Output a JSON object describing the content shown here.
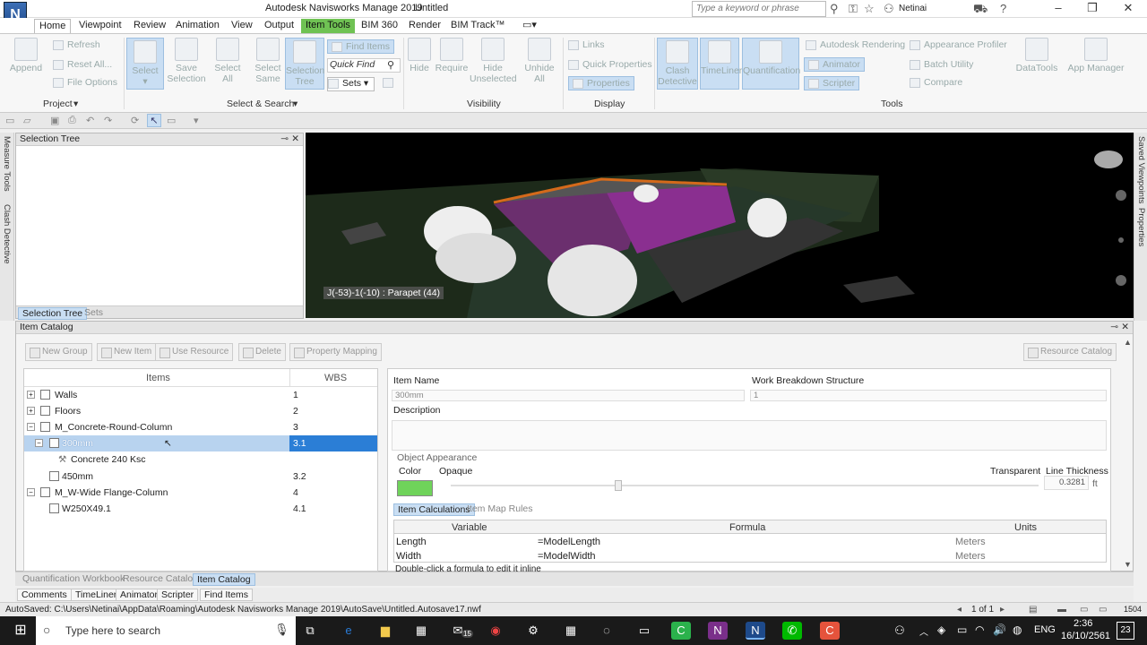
{
  "titlebar": {
    "app_title": "Autodesk Navisworks Manage 2019",
    "doc_title": "Untitled",
    "logo_letter": "N",
    "search_placeholder": "Type a keyword or phrase",
    "user": "Netinai"
  },
  "tabs": [
    "Home",
    "Viewpoint",
    "Review",
    "Animation",
    "View",
    "Output",
    "Item Tools",
    "BIM 360",
    "Render",
    "BIM Track™"
  ],
  "ribbon": {
    "project": {
      "append": "Append",
      "refresh": "Refresh",
      "reset_all": "Reset All...",
      "file_options": "File Options",
      "label": "Project"
    },
    "select_search": {
      "select": "Select",
      "save_selection": "Save Selection",
      "select_all": "Select All",
      "select_same": "Select Same",
      "selection_tree": "Selection Tree",
      "find_items": "Find Items",
      "quick_find": "Quick Find",
      "sets": "Sets",
      "label": "Select & Search"
    },
    "visibility": {
      "hide": "Hide",
      "require": "Require",
      "hide_unselected": "Hide Unselected",
      "unhide_all": "Unhide All",
      "label": "Visibility"
    },
    "display": {
      "links": "Links",
      "quick_properties": "Quick Properties",
      "properties": "Properties",
      "label": "Display"
    },
    "tools": {
      "clash_detective": "Clash Detective",
      "timeliner": "TimeLiner",
      "quantification": "Quantification",
      "autodesk_rendering": "Autodesk Rendering",
      "animator": "Animator",
      "scripter": "Scripter",
      "appearance_profiler": "Appearance Profiler",
      "batch_utility": "Batch Utility",
      "compare": "Compare",
      "datatools": "DataTools",
      "app_manager": "App Manager",
      "label": "Tools"
    }
  },
  "side_left": [
    "Measure Tools",
    "Clash Detective"
  ],
  "side_right": [
    "Saved Viewpoints",
    "Properties"
  ],
  "selection_tree": {
    "title": "Selection Tree",
    "tabs": [
      "Selection Tree",
      "Sets"
    ]
  },
  "viewport": {
    "tooltip": "J(-53)-1(-10) : Parapet (44)"
  },
  "item_catalog": {
    "title": "Item Catalog",
    "buttons": [
      "New Group",
      "New Item",
      "Use Resource",
      "Delete",
      "Property Mapping"
    ],
    "resource_catalog": "Resource Catalog",
    "tree_headers": {
      "items": "Items",
      "wbs": "WBS"
    },
    "tree_rows": [
      {
        "name": "Walls",
        "wbs": "1"
      },
      {
        "name": "Floors",
        "wbs": "2"
      },
      {
        "name": "M_Concrete-Round-Column",
        "wbs": "3"
      },
      {
        "name": "300mm",
        "wbs": "3.1"
      },
      {
        "name": "Concrete 240 Ksc",
        "wbs": ""
      },
      {
        "name": "450mm",
        "wbs": "3.2"
      },
      {
        "name": "M_W-Wide Flange-Column",
        "wbs": "4"
      },
      {
        "name": "W250X49.1",
        "wbs": "4.1"
      }
    ],
    "details": {
      "item_name_label": "Item Name",
      "item_name_value": "300mm",
      "wbs_label": "Work Breakdown Structure",
      "wbs_value": "1",
      "description_label": "Description",
      "object_appearance": "Object Appearance",
      "color_label": "Color",
      "opaque_label": "Opaque",
      "transparent_label": "Transparent",
      "line_thickness_label": "Line Thickness",
      "line_thickness_value": "0.3281",
      "line_thickness_unit": "ft",
      "color_swatch": "#6fd35a",
      "sub_tabs": [
        "Item Calculations",
        "Item Map Rules"
      ],
      "calc_headers": [
        "Variable",
        "Formula",
        "Units"
      ],
      "calc_rows": [
        {
          "variable": "Length",
          "formula": "=ModelLength",
          "units": "Meters"
        },
        {
          "variable": "Width",
          "formula": "=ModelWidth",
          "units": "Meters"
        }
      ],
      "hint": "Double-click a formula to edit it inline"
    }
  },
  "bottom_tabs1": [
    "Quantification Workbook",
    "Resource Catalog",
    "Item Catalog"
  ],
  "bottom_tabs2": [
    "Comments",
    "TimeLiner",
    "Animator",
    "Scripter",
    "Find Items"
  ],
  "status": {
    "autosave": "AutoSaved: C:\\Users\\Netinai\\AppData\\Roaming\\Autodesk Navisworks Manage 2019\\AutoSave\\Untitled.Autosave17.nwf",
    "page": "1 of 1",
    "mem": "1504"
  },
  "taskbar": {
    "search_placeholder": "Type here to search",
    "lang": "ENG",
    "time": "2:36",
    "date": "16/10/2561",
    "notif": "23",
    "mail_badge": "15"
  },
  "colors": {
    "accent": "#2b7ed6",
    "context_tab": "#6fc253",
    "selection": "#c9def3"
  }
}
